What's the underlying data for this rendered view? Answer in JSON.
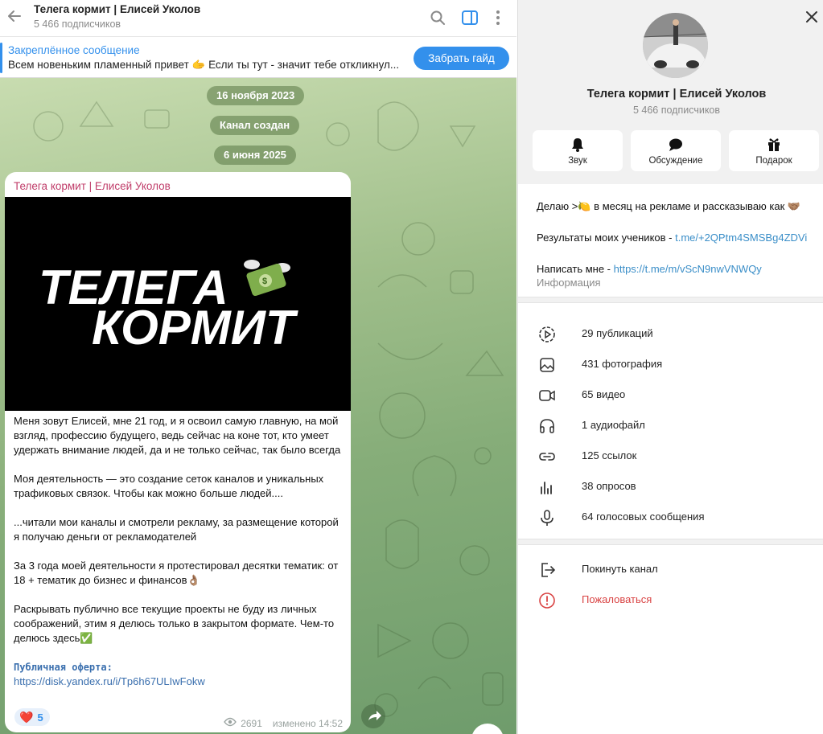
{
  "chat": {
    "title": "Телега кормит | Елисей Уколов",
    "subscribers": "5 466 подписчиков",
    "pinned": {
      "title": "Закреплённое сообщение",
      "text": "Всем новеньким пламенный привет 🫱 Если ты тут - значит тебе откликнул...",
      "button": "Забрать гайд"
    },
    "dates": [
      "16 ноября 2023",
      "Канал создан",
      "6 июня 2025"
    ],
    "message": {
      "author": "Телега кормит | Елисей Уколов",
      "image_text_line1": "ТЕЛЕГА",
      "image_text_line2": "КОРМИТ",
      "paragraphs": [
        "Меня зовут Елисей, мне 21 год, и я освоил самую главную, на мой взгляд, профессию будущего, ведь сейчас на коне тот, кто умеет удержать внимание людей, да и не только сейчас, так было всегда",
        "Моя деятельность — это создание сеток каналов и уникальных трафиковых связок. Чтобы как можно больше людей....",
        "...читали мои каналы и смотрели рекламу, за размещение которой я получаю деньги от рекламодателей",
        "За 3 года моей деятельности я протестировал десятки тематик: от 18 + тематик до бизнес и финансов👌🏽",
        "Раскрывать публично все текущие проекты не буду из личных соображений, этим я делюсь только в закрытом формате. Чем-то делюсь здесь✅"
      ],
      "offer_label": "Публичная оферта:",
      "offer_link": "https://disk.yandex.ru/i/Tp6h67ULIwFokw",
      "reaction_emoji": "❤️",
      "reaction_count": "5",
      "views": "2691",
      "edited": "изменено 14:52"
    }
  },
  "profile": {
    "name": "Телега кормит | Елисей Уколов",
    "subscribers": "5 466 подписчиков",
    "actions": [
      {
        "label": "Звук",
        "icon": "bell-icon"
      },
      {
        "label": "Обсуждение",
        "icon": "chat-bubble-icon"
      },
      {
        "label": "Подарок",
        "icon": "gift-icon"
      }
    ],
    "about": {
      "line1": "Делаю >🍋 в месяц на рекламе и рассказываю как 🤝🏽",
      "line2_prefix": "Результаты моих учеников - ",
      "line2_link": "t.me/+2QPtm4SMSBg4ZDVi",
      "line3_prefix": "Написать мне - ",
      "line3_link": "https://t.me/m/vScN9nwVNWQy",
      "caption": "Информация"
    },
    "media": [
      {
        "label": "29 публикаций",
        "icon": "posts-icon"
      },
      {
        "label": "431 фотография",
        "icon": "photo-icon"
      },
      {
        "label": "65 видео",
        "icon": "video-icon"
      },
      {
        "label": "1 аудиофайл",
        "icon": "headphones-icon"
      },
      {
        "label": "125 ссылок",
        "icon": "link-icon"
      },
      {
        "label": "38 опросов",
        "icon": "poll-icon"
      },
      {
        "label": "64 голосовых сообщения",
        "icon": "microphone-icon"
      }
    ],
    "leave": "Покинуть канал",
    "report": "Пожаловаться"
  },
  "colors": {
    "accent": "#3390ec",
    "author": "#c03d6a",
    "danger": "#d94343"
  }
}
